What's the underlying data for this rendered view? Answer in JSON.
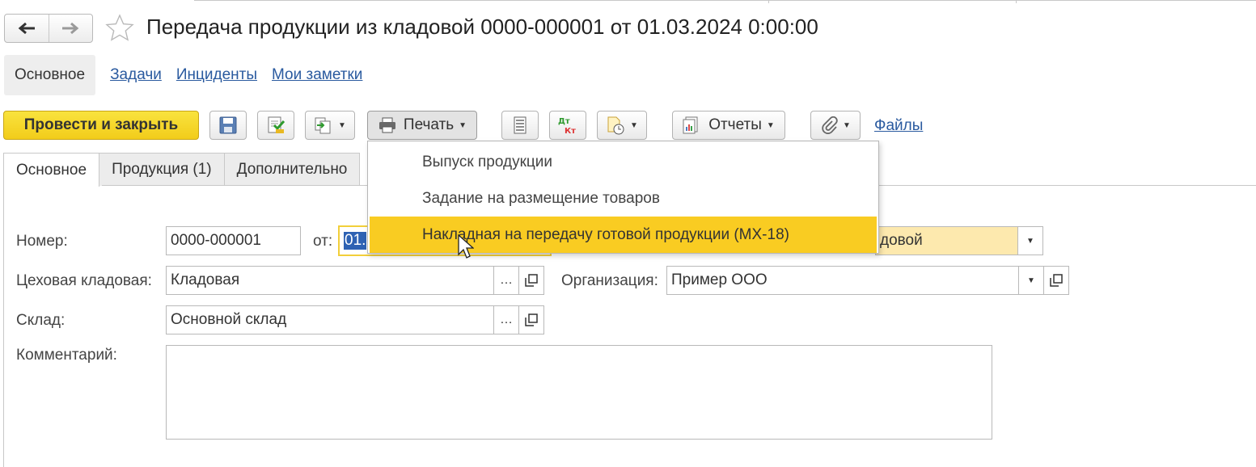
{
  "window": {
    "title": "Передача продукции из кладовой 0000-000001 от 01.03.2024 0:00:00"
  },
  "nav": {
    "back_icon": "arrow-left-icon",
    "forward_icon": "arrow-right-icon",
    "favorite_icon": "star-icon"
  },
  "sections": {
    "active": "Основное",
    "links": [
      "Задачи",
      "Инциденты",
      "Мои заметки"
    ]
  },
  "toolbar": {
    "post_close": "Провести и закрыть",
    "print": "Печать",
    "reports": "Отчеты",
    "files": "Файлы"
  },
  "form_tabs": [
    "Основное",
    "Продукция (1)",
    "Дополнительно"
  ],
  "fields": {
    "number_label": "Номер:",
    "number_value": "0000-000001",
    "date_label": "от:",
    "date_value": "01.",
    "operation_value": "довой",
    "workshop_label": "Цеховая кладовая:",
    "workshop_value": "Кладовая",
    "org_label": "Организация:",
    "org_value": "Пример ООО",
    "warehouse_label": "Склад:",
    "warehouse_value": "Основной склад",
    "comment_label": "Комментарий:"
  },
  "print_menu": {
    "items": [
      "Выпуск продукции",
      "Задание на размещение товаров",
      "Накладная на передачу готовой продукции (МХ-18)"
    ],
    "highlighted_index": 2
  },
  "colors": {
    "accent_yellow": "#f9cc22",
    "primary_button": "#f5d52a",
    "link": "#2a5a9f",
    "field_highlight": "#fde9ae",
    "selection": "#2e62b3"
  }
}
